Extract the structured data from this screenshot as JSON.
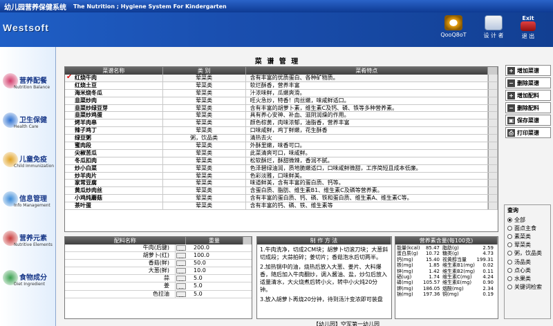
{
  "title_zh": "幼儿园营养保健系统",
  "title_en": "The Nutrition ; Hygiene System For Kindergarten",
  "logo": "Westsoft",
  "top_buttons": [
    {
      "label": "QooQ8oT",
      "icon": "help-icon"
    },
    {
      "label": "设 计 者",
      "icon": "designer-icon"
    },
    {
      "label": "Exit",
      "sub": "退 出",
      "icon": "exit-icon"
    }
  ],
  "nav": [
    {
      "zh": "营养配餐",
      "en": "Nutrition Balance",
      "icon": "dish-icon",
      "color": "#d23b6a"
    },
    {
      "zh": "卫生保健",
      "en": "Health Care",
      "icon": "health-icon",
      "color": "#2b6fd0"
    },
    {
      "zh": "儿童免疫",
      "en": "Child Immunization",
      "icon": "immunity-icon",
      "color": "#e0a020"
    },
    {
      "zh": "信息管理",
      "en": "Info Management",
      "icon": "info-icon",
      "color": "#3a8ad8"
    },
    {
      "zh": "营养元素",
      "en": "Nutritive Elements",
      "icon": "elements-icon",
      "color": "#c83a3a"
    },
    {
      "zh": "食物成分",
      "en": "Diet Ingredient",
      "icon": "ingredient-icon",
      "color": "#3aa050"
    }
  ],
  "panel_title": "菜 谱 管 理",
  "dish_headers": [
    "菜谱名称",
    "类 别",
    "菜肴特点"
  ],
  "dishes": [
    [
      "红烧牛肉",
      "荤菜类",
      "含有丰富的优质蛋白、各种矿物质。"
    ],
    [
      "红烧土豆",
      "荤菜类",
      "软烂酥香，营养丰富"
    ],
    [
      "海米烧冬瓜",
      "荤菜类",
      "汁浓味鲜，瓜嫩爽滑。"
    ],
    [
      "韭菜炒肉",
      "荤菜类",
      "旺火急炒，特香！肉丝嫩，味咸鲜适口。"
    ],
    [
      "韭菜炒绿豆芽",
      "荤菜类",
      "含有丰富的胡萝卜素，维生素C及钙、磷、铁等多种营养素。"
    ],
    [
      "韭菜炒鸡蛋",
      "荤菜类",
      "具有养心安神、补血、滋阴润燥的作用。"
    ],
    [
      "烤羊肉串",
      "荤菜类",
      "颜色棕黄，肉味浓郁，油脂香，营养丰富"
    ],
    [
      "辣子鸡丁",
      "荤菜类",
      "口味咸鲜，鸡丁鲜嫩，花生酥香"
    ],
    [
      "绿豆粥",
      "粥，饮品类",
      "清热去火"
    ],
    [
      "蜜肉段",
      "荤菜类",
      "外酥里嫩，味香可口。"
    ],
    [
      "尖椒苦瓜",
      "荤菜类",
      "此菜清爽可口，味咸鲜。"
    ],
    [
      "冬瓜扣肉",
      "荤菜类",
      "松软酥烂，酥甜微辣，香润不腻。"
    ],
    [
      "炒小白菜",
      "荤菜类",
      "色泽碧绿油润，质地脆嫩适口，口味咸鲜微甜，工序简短且成本低廉。"
    ],
    [
      "炒羊肉片",
      "荤菜类",
      "色彩淡雅，口味鲜美。"
    ],
    [
      "家常豆腐",
      "荤菜类",
      "味道鲜美，含有丰富的蛋白质、钙等。"
    ],
    [
      "黄瓜炒肉丝",
      "荤菜类",
      "含蛋白质、脂肪、维生素B1、维生素C及磷等营养素。"
    ],
    [
      "小鸡炖蘑菇",
      "荤菜类",
      "含有丰富的蛋白质、钙、磷、铁和蛋白质、维生素A、维生素C等。"
    ],
    [
      "茶叶蛋",
      "荤菜类",
      "含有丰富的钙、磷、铁、维生素等"
    ]
  ],
  "actions": [
    {
      "label": "增加菜谱",
      "icon": "+"
    },
    {
      "label": "删除菜谱",
      "icon": "−"
    },
    {
      "label": "增加配料",
      "icon": "+"
    },
    {
      "label": "删除配料",
      "icon": "−"
    },
    {
      "label": "保存菜谱",
      "icon": "▣"
    },
    {
      "label": "打印菜谱",
      "icon": "⎙"
    }
  ],
  "ingred_headers": [
    "配料名称",
    "重量"
  ],
  "ingredients": [
    [
      "牛肉(后腱)",
      "200.0"
    ],
    [
      "胡萝卜(红)",
      "100.0"
    ],
    [
      "香菇(鲜)",
      "50.0"
    ],
    [
      "大葱(鲜)",
      "10.0"
    ],
    [
      "蒜",
      "5.0"
    ],
    [
      "姜",
      "5.0"
    ],
    [
      "色拉油",
      "5.0"
    ]
  ],
  "ingred_btn": "…",
  "steps_header": "制 作 方 法",
  "steps": "1.牛肉洗净，切成2CM块；胡萝卜切滚刀块；大葱斜切成段；大蒜拍碎；姜切片；香菇泡水后切两半。\n2.加热锅中的油，烧热后放入大葱、姜片、大料爆香，随后加入牛肉翻炒，调入酱油、盐，炒匀后放入适量清水，大火烧煮后转小火，转中小火炖20分钟。\n3.放入胡萝卜再烧20分钟，待到汤汁变浓即可装盘",
  "nutri_header": "营养素含量(每100克)",
  "nutrients": [
    [
      "能量(kcal)",
      "85.47",
      "脂肪(g)",
      "2.59"
    ],
    [
      "蛋白质(g)",
      "10.72",
      "糖类(g)",
      "4.73"
    ],
    [
      "钙(mg)",
      "15.40",
      "视黄醇当量",
      "199.31"
    ],
    [
      "铁(mg)",
      "1.85",
      "维生素B1(mg)",
      "0.02"
    ],
    [
      "锌(mg)",
      "1.42",
      "维生素B2(mg)",
      "0.11"
    ],
    [
      "硒(ug)",
      "1.74",
      "维生素C(mg)",
      "4.24"
    ],
    [
      "磷(mg)",
      "105.57",
      "维生素E(mg)",
      "0.90"
    ],
    [
      "钾(mg)",
      "186.05",
      "烟酸(mg)",
      "2.34"
    ],
    [
      "钠(mg)",
      "197.36",
      "铜(mg)",
      "0.19"
    ]
  ],
  "query_title": "查询",
  "query_options": [
    {
      "label": "全部",
      "selected": true
    },
    {
      "label": "面点主食",
      "selected": false
    },
    {
      "label": "素菜类",
      "selected": false
    },
    {
      "label": "荤菜类",
      "selected": false
    },
    {
      "label": "粥，饮品类",
      "selected": false
    },
    {
      "label": "汤品类",
      "selected": false
    },
    {
      "label": "点心类",
      "selected": false
    },
    {
      "label": "水果类",
      "selected": false
    },
    {
      "label": "关键词检索",
      "selected": false
    }
  ],
  "status": "【幼儿园】空军第一幼儿园"
}
